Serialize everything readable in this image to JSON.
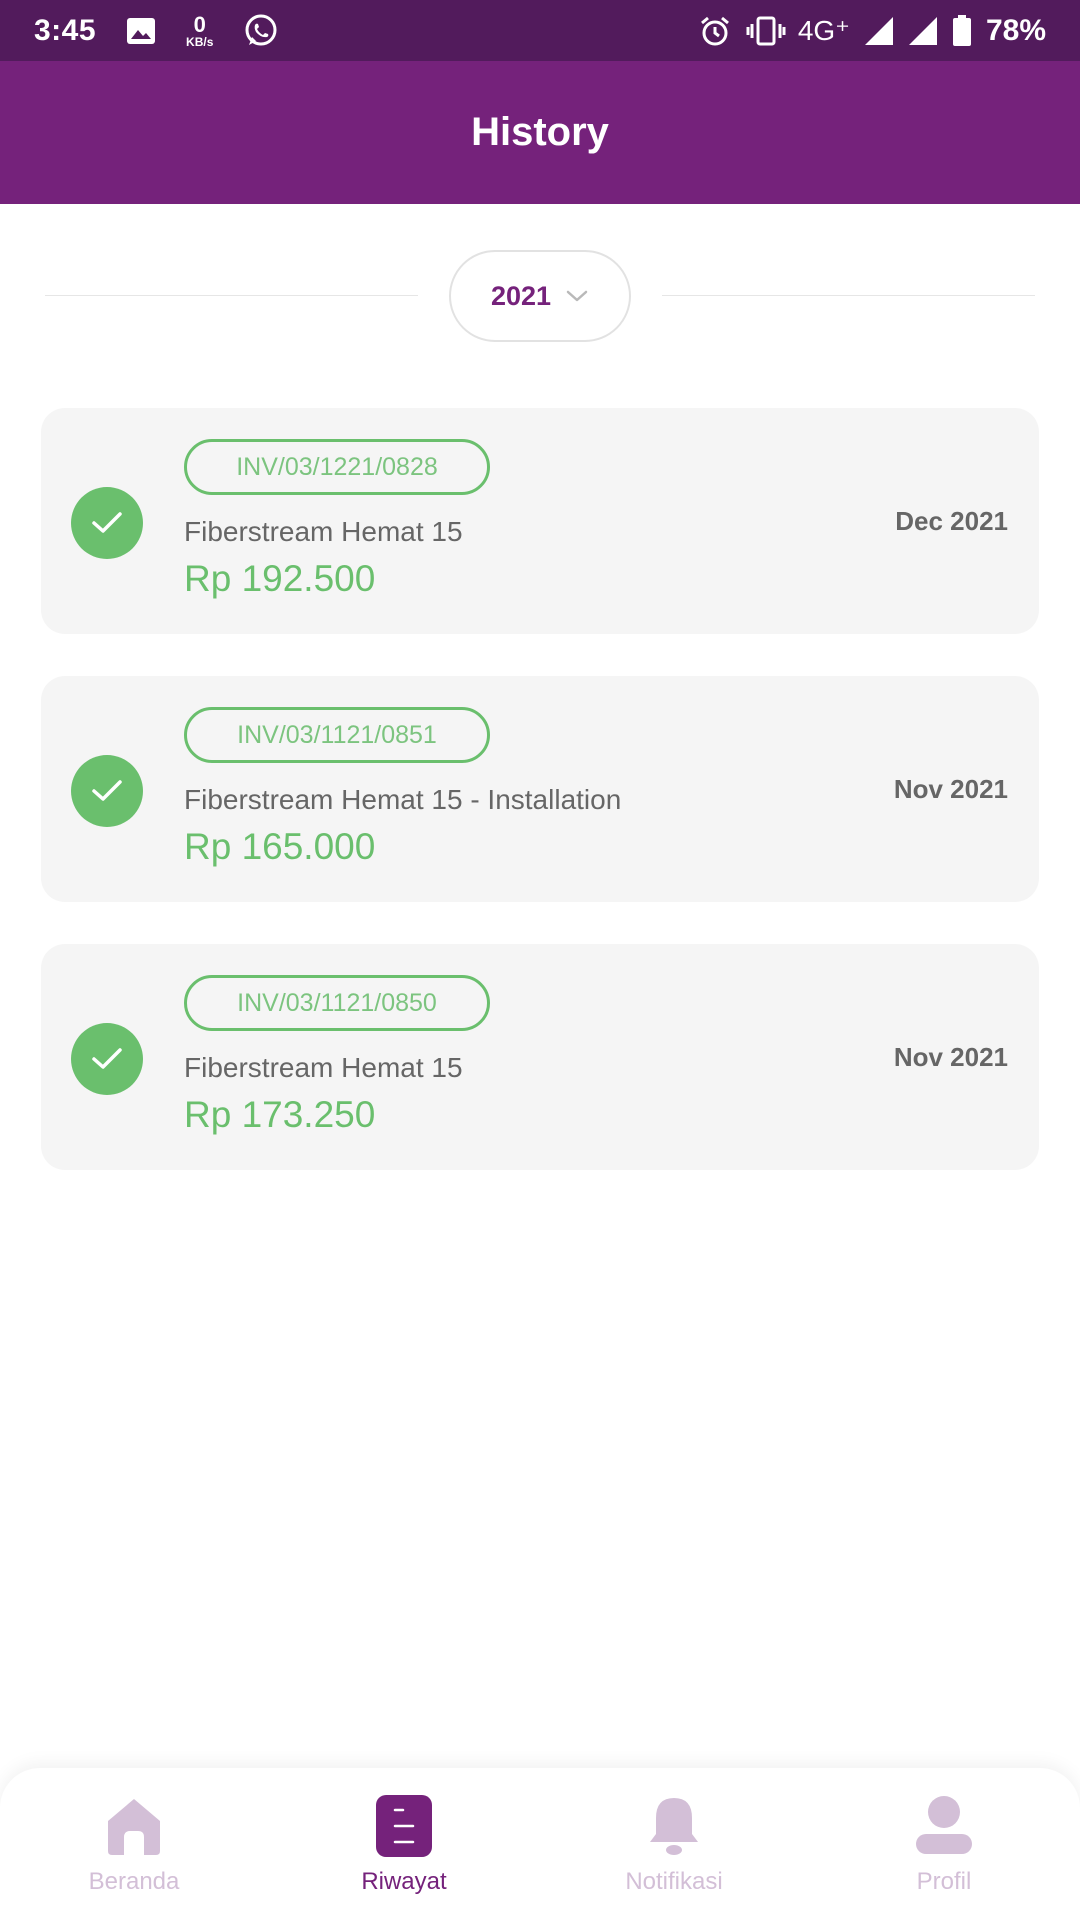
{
  "status_bar": {
    "time": "3:45",
    "speed_value": "0",
    "speed_unit": "KB/s",
    "network": "4G⁺",
    "battery": "78%",
    "icons": [
      "image-icon",
      "whatsapp-icon",
      "alarm-icon",
      "vibrate-icon",
      "signal-icon",
      "signal-icon",
      "battery-icon"
    ]
  },
  "header": {
    "title": "History"
  },
  "year_selector": {
    "value": "2021",
    "icon": "chevron-down-icon"
  },
  "history": [
    {
      "invoice": "INV/03/1221/0828",
      "product": "Fiberstream Hemat 15",
      "amount": "Rp 192.500",
      "period": "Dec 2021",
      "status_icon": "check-icon"
    },
    {
      "invoice": "INV/03/1121/0851",
      "product": "Fiberstream Hemat 15 - Installation",
      "amount": "Rp 165.000",
      "period": "Nov 2021",
      "status_icon": "check-icon"
    },
    {
      "invoice": "INV/03/1121/0850",
      "product": "Fiberstream Hemat 15",
      "amount": "Rp 173.250",
      "period": "Nov 2021",
      "status_icon": "check-icon"
    }
  ],
  "bottom_nav": [
    {
      "label": "Beranda",
      "icon": "home-icon",
      "active": false
    },
    {
      "label": "Riwayat",
      "icon": "history-icon",
      "active": true
    },
    {
      "label": "Notifikasi",
      "icon": "bell-icon",
      "active": false
    },
    {
      "label": "Profil",
      "icon": "user-icon",
      "active": false
    }
  ],
  "colors": {
    "status_bar": "#521b5c",
    "primary": "#75227b",
    "success": "#6abf6d",
    "card_bg": "#f5f5f5",
    "nav_inactive": "#d3bfd7"
  }
}
